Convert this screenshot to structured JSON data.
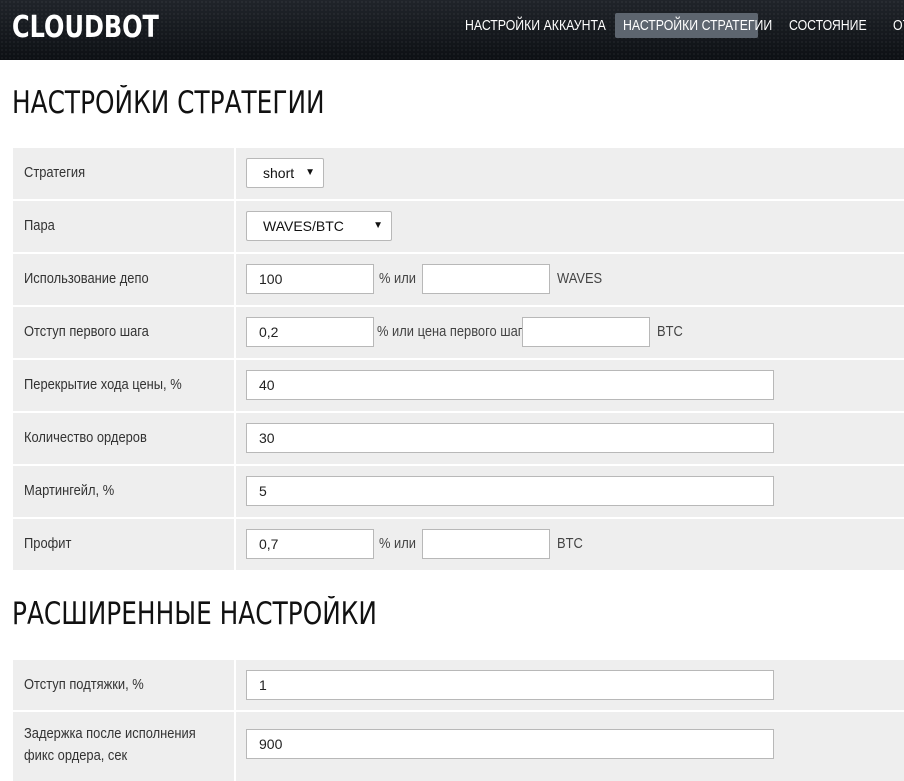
{
  "header": {
    "logo": "CLOUDBOT",
    "nav": [
      {
        "label": "НАСТРОЙКИ АККАУНТА",
        "active": false
      },
      {
        "label": "НАСТРОЙКИ СТРАТЕГИИ",
        "active": true
      },
      {
        "label": "СОСТОЯНИЕ",
        "active": false
      },
      {
        "label": "ОТ",
        "active": false
      }
    ]
  },
  "strategy_section": {
    "title": "НАСТРОЙКИ СТРАТЕГИИ",
    "rows": {
      "strategy": {
        "label": "Стратегия",
        "selected": "short"
      },
      "pair": {
        "label": "Пара",
        "selected": "WAVES/BTC"
      },
      "deposit": {
        "label": "Использование депо",
        "value": "100",
        "separator": "%  или",
        "alt_value": "",
        "unit": "WAVES"
      },
      "first_step": {
        "label": "Отступ первого шага",
        "value": "0,2",
        "separator": "% или цена первого шага",
        "alt_value": "",
        "unit": "BTC"
      },
      "overlap": {
        "label": "Перекрытие хода цены, %",
        "value": "40"
      },
      "orders": {
        "label": "Количество ордеров",
        "value": "30"
      },
      "martingale": {
        "label": "Мартингейл, %",
        "value": "5"
      },
      "profit": {
        "label": "Профит",
        "value": "0,7",
        "separator": "%  или",
        "alt_value": "",
        "unit": "BTC"
      }
    }
  },
  "advanced_section": {
    "title": "РАСШИРЕННЫЕ НАСТРОЙКИ",
    "rows": {
      "trailing": {
        "label": "Отступ подтяжки, %",
        "value": "1"
      },
      "delay": {
        "label": "Задержка после исполнения фикс ордера, сек",
        "value": "900"
      }
    }
  },
  "colors": {
    "header_bg": "#14181d",
    "nav_active_bg": "#5d656f",
    "row_bg": "#eeeeee",
    "input_border": "#b8b8b8"
  }
}
